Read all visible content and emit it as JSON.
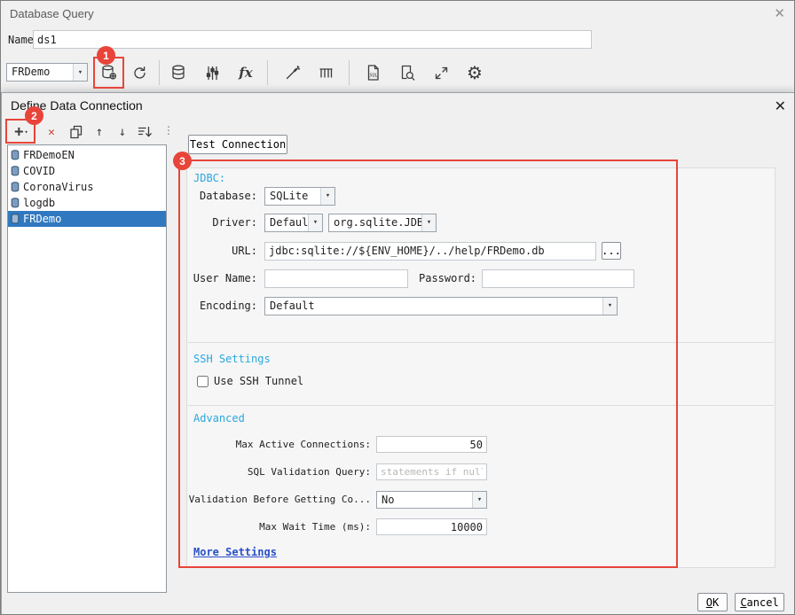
{
  "icons": {
    "chevron_down": "▾",
    "close": "✕",
    "gear": "⚙",
    "plus": "+",
    "delete": "✕",
    "arrow_up": "↑",
    "arrow_down": "↓",
    "dots": "⋮",
    "fx": "fx",
    "sql": "SQL"
  },
  "colors": {
    "annotation_red": "#e8443a",
    "section_cyan": "#2aa7de",
    "selection_blue": "#3079c0",
    "link_blue": "#2b50c8"
  },
  "window": {
    "title": "Database Query"
  },
  "name_row": {
    "label": "Name:",
    "value": "ds1"
  },
  "toolbar": {
    "dataset_value": "FRDemo"
  },
  "dialog": {
    "title": "Define Data Connection",
    "test_connection_label": "Test Connection",
    "connections": [
      "FRDemoEN",
      "COVID",
      "CoronaVirus",
      "logdb",
      "FRDemo"
    ],
    "selected_connection": "FRDemo",
    "jdbc": {
      "section_label": "JDBC:",
      "database_label": "Database:",
      "database_value": "SQLite",
      "driver_label": "Driver:",
      "driver_mode_value": "Default",
      "driver_class_value": "org.sqlite.JDBC",
      "url_label": "URL:",
      "url_value": "jdbc:sqlite://${ENV_HOME}/../help/FRDemo.db",
      "browse_label": "...",
      "user_label": "User Name:",
      "password_label": "Password:",
      "encoding_label": "Encoding:",
      "encoding_value": "Default"
    },
    "ssh": {
      "section_label": "SSH Settings",
      "use_tunnel_label": "Use SSH Tunnel"
    },
    "advanced": {
      "section_label": "Advanced",
      "rows": [
        {
          "label": "Max Active Connections:",
          "value": "50"
        },
        {
          "label": "SQL Validation Query:",
          "placeholder": "statements if null."
        },
        {
          "label": "Validation Before Getting Co...",
          "value": "No"
        },
        {
          "label": "Max Wait Time (ms):",
          "value": "10000"
        }
      ],
      "more_settings_label": "More Settings"
    },
    "footer": {
      "ok_label": "OK",
      "cancel_label": "Cancel"
    }
  },
  "annotations": {
    "step1": "1",
    "step2": "2",
    "step3": "3"
  }
}
